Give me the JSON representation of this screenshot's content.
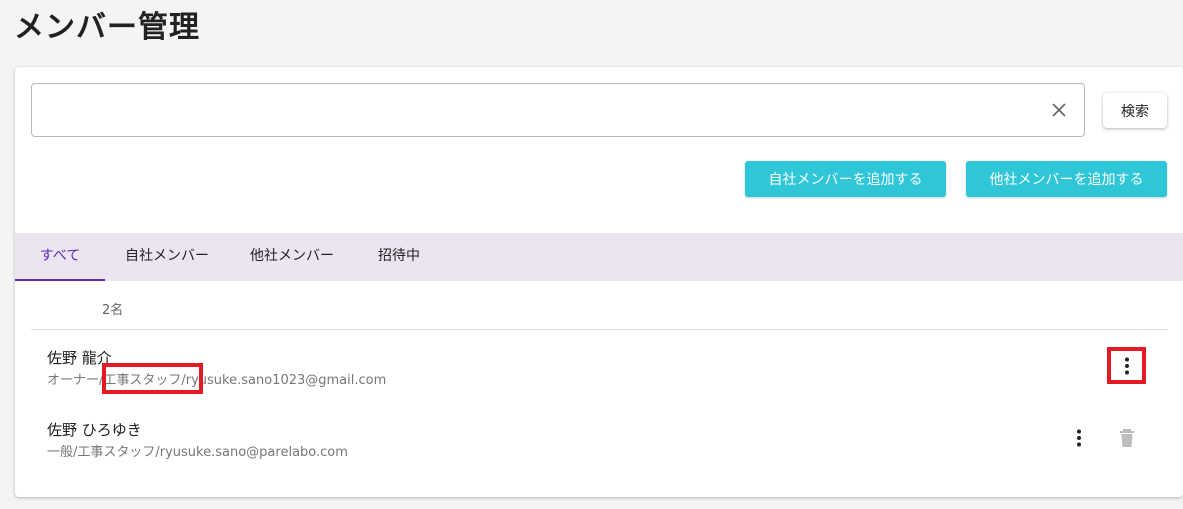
{
  "page": {
    "title": "メンバー管理"
  },
  "search": {
    "value": "",
    "placeholder": "",
    "button_label": "検索",
    "clear_icon": "close-icon"
  },
  "actions": {
    "add_own_label": "自社メンバーを追加する",
    "add_other_label": "他社メンバーを追加する",
    "button_color": "#2fc7d8"
  },
  "tabs": [
    {
      "label": "すべて",
      "active": true
    },
    {
      "label": "自社メンバー",
      "active": false
    },
    {
      "label": "他社メンバー",
      "active": false
    },
    {
      "label": "招待中",
      "active": false
    }
  ],
  "list": {
    "count_label": "2名",
    "members": [
      {
        "name": "佐野 龍介",
        "detail": "オーナー/工事スタッフ/ryusuke.sano1023@gmail.com",
        "menu_icon": "more-vert-icon"
      },
      {
        "name": "佐野 ひろゆき",
        "detail": "一般/工事スタッフ/ryusuke.sano@parelabo.com",
        "menu_icon": "more-vert-icon",
        "delete_icon": "trash-icon"
      }
    ]
  },
  "theme": {
    "accent": "#5b2bb0",
    "tab_bar_bg": "#ebe4f1",
    "annotation_red": "#e01b24"
  }
}
